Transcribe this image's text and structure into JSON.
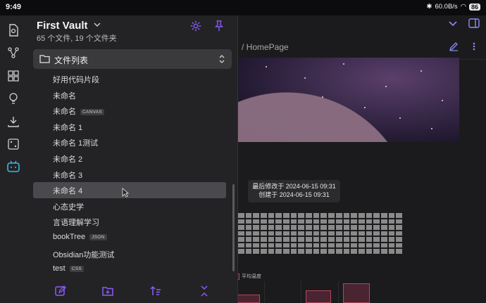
{
  "status": {
    "time": "9:49",
    "speed": "60.0B/s",
    "battery": "86"
  },
  "drawer": {
    "title": "First Vault",
    "subtitle": "65 个文件, 19 个文件夹",
    "selector_label": "文件列表",
    "files": [
      {
        "name": "好用代码片段",
        "tag": ""
      },
      {
        "name": "未命名",
        "tag": ""
      },
      {
        "name": "未命名",
        "tag": "CANVAS"
      },
      {
        "name": "未命名 1",
        "tag": ""
      },
      {
        "name": "未命名 1测试",
        "tag": ""
      },
      {
        "name": "未命名 2",
        "tag": ""
      },
      {
        "name": "未命名 3",
        "tag": ""
      },
      {
        "name": "未命名 4",
        "tag": ""
      },
      {
        "name": "心态史学",
        "tag": ""
      },
      {
        "name": "言语理解学习",
        "tag": ""
      },
      {
        "name": "bookTree",
        "tag": "JSON"
      },
      {
        "name": "Obsidian功能测试",
        "tag": ""
      },
      {
        "name": "test",
        "tag": "CSS"
      }
    ]
  },
  "main": {
    "breadcrumb": "/ HomePage",
    "tooltip": {
      "modified": "最后修改于 2024-06-15 09:31",
      "created": "创建于 2024-06-15 09:31"
    },
    "legend_label": "平均温度"
  },
  "colors": {
    "accent": "#8b5cf6",
    "rail_accent": "#3fb6e0"
  }
}
